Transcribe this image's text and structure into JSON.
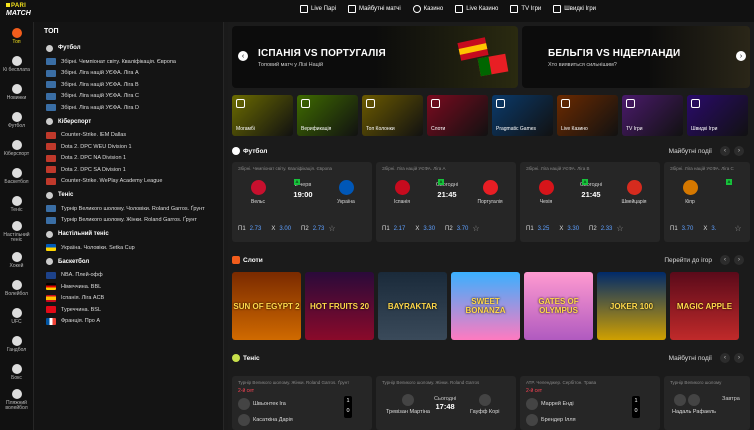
{
  "logo": {
    "line1": "PARI",
    "line2": "MATCH"
  },
  "topnav": [
    "Live Парі",
    "Майбутні матчі",
    "Казино",
    "Live Казино",
    "TV Ігри",
    "Швидкі Ігри"
  ],
  "rail": [
    {
      "label": "Топ",
      "active": true
    },
    {
      "label": "Кі бесплата",
      "active": false
    },
    {
      "label": "Новинки",
      "active": false
    },
    {
      "label": "Футбол",
      "active": false
    },
    {
      "label": "Кіберспорт",
      "active": false
    },
    {
      "label": "Баскетбол",
      "active": false
    },
    {
      "label": "Теніс",
      "active": false
    },
    {
      "label": "Настільний теніс",
      "active": false
    },
    {
      "label": "Хокей",
      "active": false
    },
    {
      "label": "Волейбол",
      "active": false
    },
    {
      "label": "UFC",
      "active": false
    },
    {
      "label": "Гандбол",
      "active": false
    },
    {
      "label": "Бокс",
      "active": false
    },
    {
      "label": "Пляжний волейбол",
      "active": false
    }
  ],
  "sidebar": {
    "title": "ТОП",
    "groups": [
      {
        "name": "Футбол",
        "items": [
          "Збірні. Чемпіонат світу. Кваліфікація. Європа",
          "Збірні. Ліга націй УЄФА. Ліга А",
          "Збірні. Ліга націй УЄФА. Ліга B",
          "Збірні. Ліга націй УЄФА. Ліга C",
          "Збірні. Ліга націй УЄФА. Ліга D"
        ]
      },
      {
        "name": "Кіберспорт",
        "items": [
          "Counter-Strike. IEM Dallas",
          "Dota 2. DPC WEU Division 1",
          "Dota 2. DPC NA Division 1",
          "Dota 2. DPC SA Division 1",
          "Counter-Strike. WePlay Academy League"
        ]
      },
      {
        "name": "Теніс",
        "items": [
          "Турнір Великого шолому. Чоловіки. Roland Garros. Ґрунт",
          "Турнір Великого шолому. Жінки. Roland Garros. Ґрунт"
        ]
      },
      {
        "name": "Настільний теніс",
        "items": [
          "Україна. Чоловіки. Setka Cup"
        ]
      },
      {
        "name": "Баскетбол",
        "items": [
          "NBA. Плей-офф",
          "Німеччина. BBL",
          "Іспанія. Ліга ACB",
          "Туреччина. BSL",
          "Франція. Про А"
        ]
      }
    ]
  },
  "banners": [
    {
      "title": "ІСПАНІЯ VS ПОРТУГАЛІЯ",
      "subtitle": "Топовий матч у Лізі Націй"
    },
    {
      "title": "БЕЛЬГІЯ VS НІДЕРЛАНДИ",
      "subtitle": "Хто виявиться сильнішим?"
    }
  ],
  "tiles": [
    "Могамбі",
    "Верификація",
    "Топ Колонки",
    "Слоти",
    "Pragmatic Games",
    "Live Казино",
    "TV Ігри",
    "Швидкі Ігри"
  ],
  "football": {
    "title": "Футбол",
    "right": "Майбутні події",
    "matches": [
      {
        "league": "Збірні. Чемпіонат світу. Кваліфікація. Європа",
        "home": "Вельс",
        "away": "Україна",
        "date": "2 черв",
        "time": "19:00",
        "o1": "2.73",
        "ox": "3.00",
        "o2": "2.73",
        "lab1": "П1",
        "labx": "X",
        "lab2": "П2"
      },
      {
        "league": "Збірні. Ліга націй УЄФА. Ліга А",
        "home": "Іспанія",
        "away": "Португалія",
        "date": "Сьогодні",
        "time": "21:45",
        "o1": "2.17",
        "ox": "3.30",
        "o2": "3.70",
        "lab1": "П1",
        "labx": "X",
        "lab2": "П2"
      },
      {
        "league": "Збірні. Ліга націй УЄФА. Ліга В",
        "home": "Чехія",
        "away": "Швейцарія",
        "date": "Сьогодні",
        "time": "21:45",
        "o1": "3.25",
        "ox": "3.30",
        "o2": "2.33",
        "lab1": "П1",
        "labx": "X",
        "lab2": "П2"
      },
      {
        "league": "Збірні. Ліга націй УЄФА. Ліга С",
        "home": "Кіпр",
        "away": "",
        "date": "",
        "time": "",
        "o1": "3.70",
        "ox": "3.",
        "o2": "",
        "lab1": "П1",
        "labx": "X",
        "lab2": ""
      }
    ]
  },
  "slots": {
    "title": "Слоти",
    "right": "Перейти до ігор",
    "items": [
      "SUN OF EGYPT 2",
      "HOT FRUITS 20",
      "BAYRAKTAR",
      "SWEET BONANZA",
      "GATES OF OLYMPUS",
      "JOKER 100",
      "MAGIC APPLE"
    ]
  },
  "tennis": {
    "title": "Теніс",
    "right": "Майбутні події",
    "matches": [
      {
        "league": "Турнір Великого шолому. Жінки. Roland Garros. Ґрунт",
        "set": "2-й сет",
        "p1": "Швьонтек Іга",
        "p2": "Касаткіна Дарія",
        "s1": "1",
        "s2": "0"
      },
      {
        "league": "Турнір Великого шолому. Жінки. Roland Garros",
        "set": "",
        "p1": "Тревізан Мартіна",
        "p2": "Гауфф Корі",
        "date": "Сьогодні",
        "time": "17:48"
      },
      {
        "league": "ATP. Челенджер. Сербітон. Трава",
        "set": "2-й сет",
        "p1": "Маррей Енді",
        "p2": "Брендер Ілля",
        "s1": "1",
        "s2": "0"
      },
      {
        "league": "Турнір Великого шолому",
        "set": "",
        "p1": "",
        "p2": "Надаль Рафаель",
        "date": "Завтра",
        "time": ""
      }
    ]
  }
}
